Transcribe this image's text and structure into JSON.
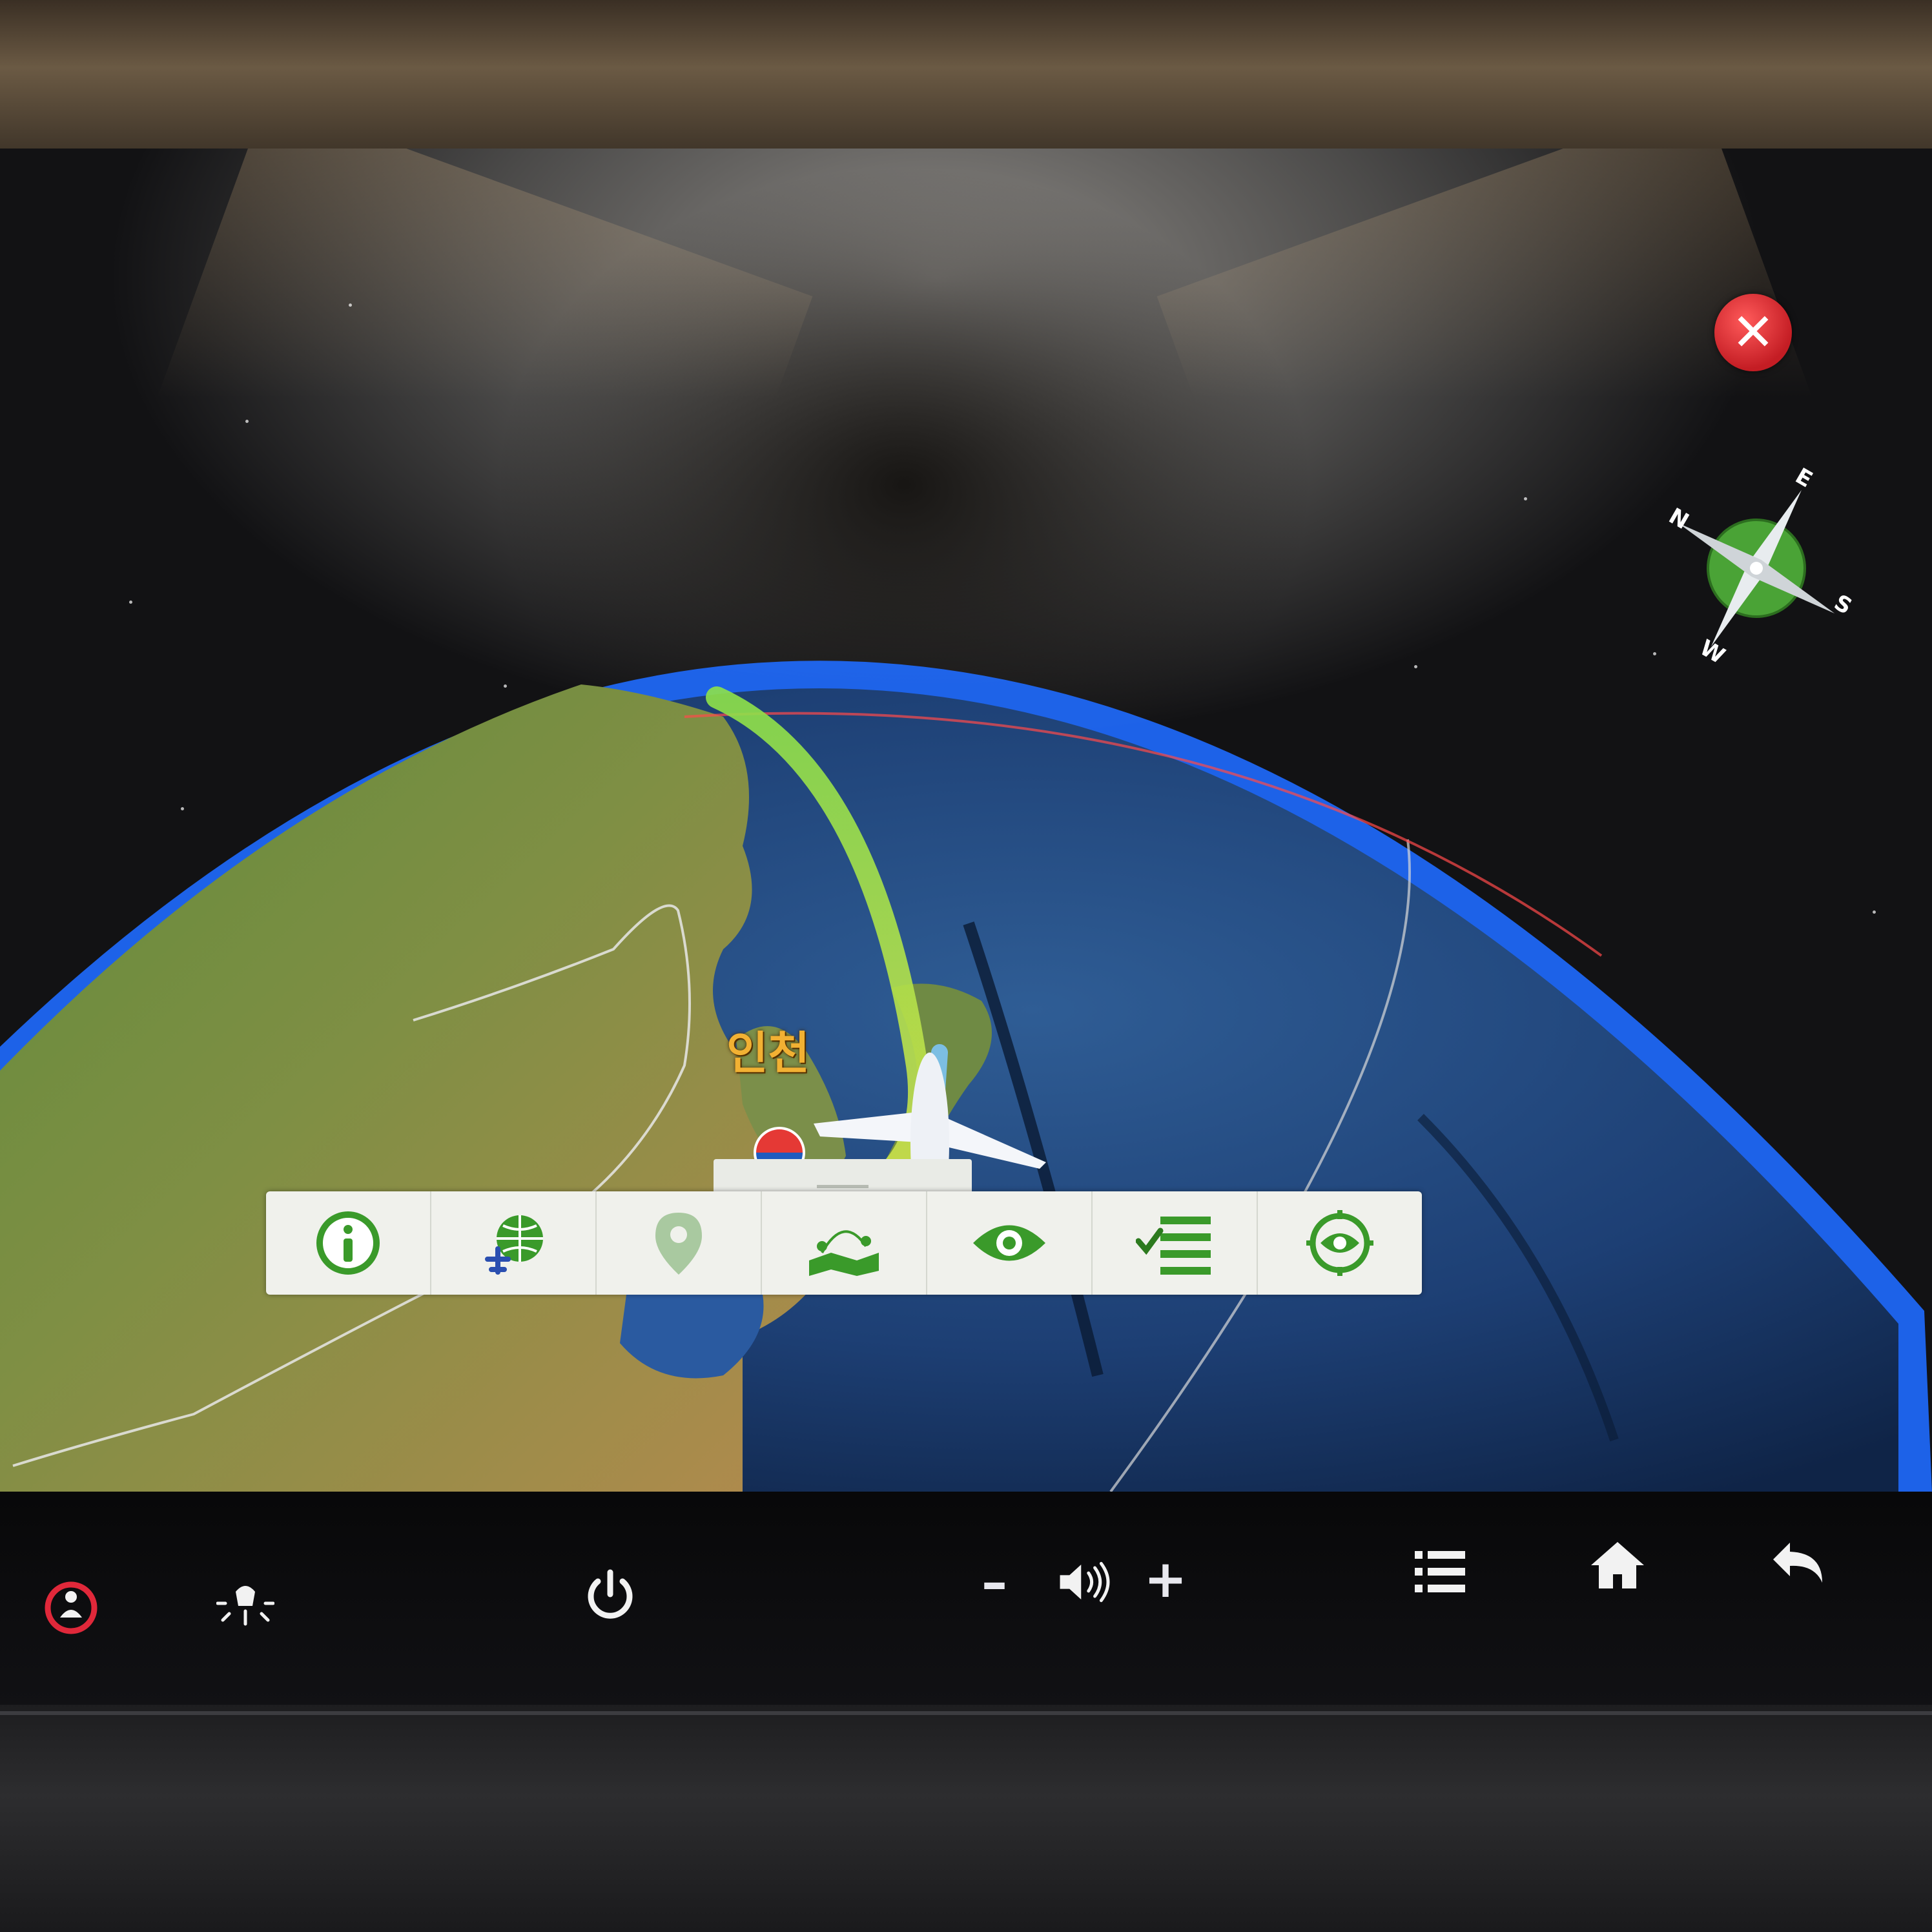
{
  "map": {
    "origin_label": "인천"
  },
  "compass": {
    "north": "N",
    "east": "E",
    "south": "S",
    "west": "W"
  },
  "close_button": {
    "icon": "close-icon",
    "color": "#d1232a"
  },
  "toolbar": {
    "accent_color": "#3a9a2a",
    "items": [
      {
        "icon": "info-icon"
      },
      {
        "icon": "globe-plane-icon"
      },
      {
        "icon": "location-pin-icon"
      },
      {
        "icon": "route-map-icon"
      },
      {
        "icon": "eye-icon"
      },
      {
        "icon": "checklist-icon"
      },
      {
        "icon": "recenter-icon"
      }
    ]
  },
  "hardware_buttons": {
    "items": [
      {
        "icon": "attendant-call-icon"
      },
      {
        "icon": "reading-light-icon"
      },
      {
        "icon": "power-icon"
      },
      {
        "icon": "volume-down-icon",
        "label": "–"
      },
      {
        "icon": "volume-icon"
      },
      {
        "icon": "volume-up-icon",
        "label": "+"
      },
      {
        "icon": "menu-icon"
      },
      {
        "icon": "home-icon"
      },
      {
        "icon": "back-icon"
      }
    ]
  }
}
